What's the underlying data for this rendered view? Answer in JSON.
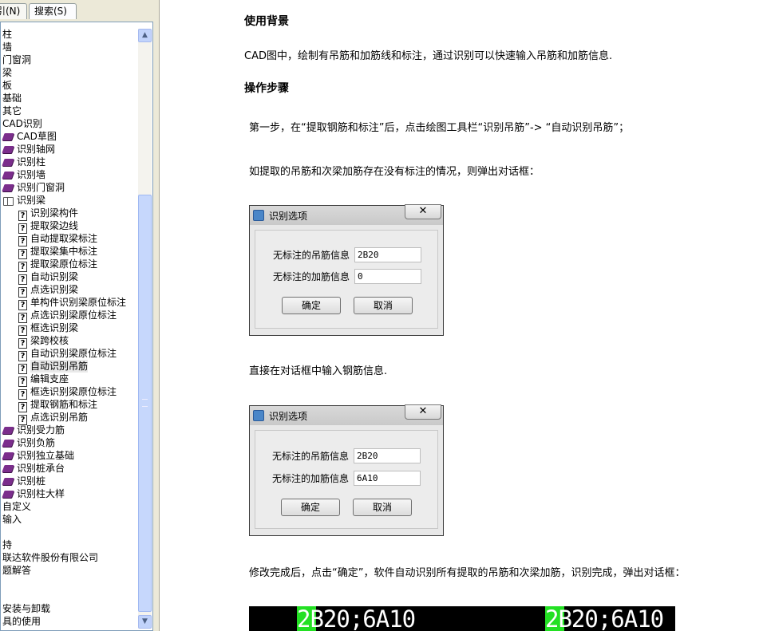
{
  "left_pane": {
    "tabs": [
      "引(N)",
      "搜索(S)"
    ],
    "tree": [
      {
        "label": "柱",
        "icon": "none",
        "indent": 0
      },
      {
        "label": "墙",
        "icon": "none",
        "indent": 0
      },
      {
        "label": "门窗洞",
        "icon": "none",
        "indent": 0
      },
      {
        "label": "梁",
        "icon": "none",
        "indent": 0
      },
      {
        "label": "板",
        "icon": "none",
        "indent": 0
      },
      {
        "label": "基础",
        "icon": "none",
        "indent": 0
      },
      {
        "label": "其它",
        "icon": "none",
        "indent": 0
      },
      {
        "label": "CAD识别",
        "icon": "none",
        "indent": 0
      },
      {
        "label": "CAD草图",
        "icon": "book",
        "indent": 1
      },
      {
        "label": "识别轴网",
        "icon": "book",
        "indent": 1
      },
      {
        "label": "识别柱",
        "icon": "book",
        "indent": 1
      },
      {
        "label": "识别墙",
        "icon": "book",
        "indent": 1
      },
      {
        "label": "识别门窗洞",
        "icon": "book",
        "indent": 1
      },
      {
        "label": "识别梁",
        "icon": "book-open",
        "indent": 1
      },
      {
        "label": "识别梁构件",
        "icon": "topic",
        "indent": 2
      },
      {
        "label": "提取梁边线",
        "icon": "topic",
        "indent": 2
      },
      {
        "label": "自动提取梁标注",
        "icon": "topic",
        "indent": 2
      },
      {
        "label": "提取梁集中标注",
        "icon": "topic",
        "indent": 2
      },
      {
        "label": "提取梁原位标注",
        "icon": "topic",
        "indent": 2
      },
      {
        "label": "自动识别梁",
        "icon": "topic",
        "indent": 2
      },
      {
        "label": "点选识别梁",
        "icon": "topic",
        "indent": 2
      },
      {
        "label": "单构件识别梁原位标注",
        "icon": "topic",
        "indent": 2
      },
      {
        "label": "点选识别梁原位标注",
        "icon": "topic",
        "indent": 2
      },
      {
        "label": "框选识别梁",
        "icon": "topic",
        "indent": 2
      },
      {
        "label": "梁跨校核",
        "icon": "topic",
        "indent": 2
      },
      {
        "label": "自动识别梁原位标注",
        "icon": "topic",
        "indent": 2
      },
      {
        "label": "自动识别吊筋",
        "icon": "topic",
        "indent": 2,
        "selected": true
      },
      {
        "label": "编辑支座",
        "icon": "topic",
        "indent": 2
      },
      {
        "label": "框选识别梁原位标注",
        "icon": "topic",
        "indent": 2
      },
      {
        "label": "提取钢筋和标注",
        "icon": "topic",
        "indent": 2
      },
      {
        "label": "点选识别吊筋",
        "icon": "topic",
        "indent": 2
      },
      {
        "label": "识别受力筋",
        "icon": "book",
        "indent": 1
      },
      {
        "label": "识别负筋",
        "icon": "book",
        "indent": 1
      },
      {
        "label": "识别独立基础",
        "icon": "book",
        "indent": 1
      },
      {
        "label": "识别桩承台",
        "icon": "book",
        "indent": 1
      },
      {
        "label": "识别桩",
        "icon": "book",
        "indent": 1
      },
      {
        "label": "识别柱大样",
        "icon": "book",
        "indent": 1
      },
      {
        "label": "自定义",
        "icon": "none",
        "indent": 0
      },
      {
        "label": "输入",
        "icon": "none",
        "indent": 0
      },
      {
        "label": "",
        "icon": "none",
        "indent": 0
      },
      {
        "label": "持",
        "icon": "none",
        "indent": 0
      },
      {
        "label": "联达软件股份有限公司",
        "icon": "none",
        "indent": 0
      },
      {
        "label": "题解答",
        "icon": "none",
        "indent": 0
      },
      {
        "label": "",
        "icon": "none",
        "indent": 0
      },
      {
        "label": "",
        "icon": "none",
        "indent": 0
      },
      {
        "label": "安装与卸载",
        "icon": "none",
        "indent": 0
      },
      {
        "label": "具的使用",
        "icon": "none",
        "indent": 0
      }
    ]
  },
  "content": {
    "heading_background": "使用背景",
    "para_background": "CAD图中，绘制有吊筋和加筋线和标注，通过识别可以快速输入吊筋和加筋信息.",
    "heading_steps": "操作步骤",
    "para_step1": "第一步，在“提取钢筋和标注”后，点击绘图工具栏“识别吊筋”-> “自动识别吊筋”；",
    "para_no_label": "如提取的吊筋和次梁加筋存在没有标注的情况，则弹出对话框：",
    "para_input_direct": "直接在对话框中输入钢筋信息.",
    "para_after": "修改完成后，点击“确定”，软件自动识别所有提取的吊筋和次梁加筋，识别完成，弹出对话框："
  },
  "dialog1": {
    "title": "识别选项",
    "close_label": "✕",
    "hanging_label": "无标注的吊筋信息",
    "hanging_value": "2B20",
    "extra_label": "无标注的加筋信息",
    "extra_value": "0",
    "ok_label": "确定",
    "cancel_label": "取消"
  },
  "dialog2": {
    "title": "识别选项",
    "close_label": "✕",
    "hanging_label": "无标注的吊筋信息",
    "hanging_value": "2B20",
    "extra_label": "无标注的加筋信息",
    "extra_value": "6A10",
    "ok_label": "确定",
    "cancel_label": "取消"
  },
  "cad_strip": {
    "text_left": "2B20;6A10",
    "text_right": "2B20;6A10",
    "background_color": "#000000",
    "text_color": "#ffffff",
    "highlight_color": "#23e023"
  }
}
